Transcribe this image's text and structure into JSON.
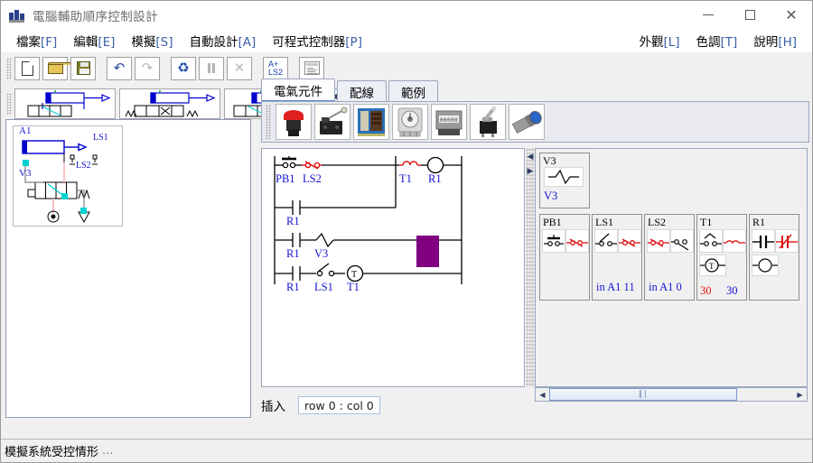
{
  "window": {
    "title": "電腦輔助順序控制設計",
    "icon": "app-icon",
    "controls": {
      "minimize": "—",
      "maximize": "□",
      "close": "✕"
    }
  },
  "menu": {
    "left": [
      {
        "label": "檔案",
        "accel": "[F]"
      },
      {
        "label": "編輯",
        "accel": "[E]"
      },
      {
        "label": "模擬",
        "accel": "[S]"
      },
      {
        "label": "自動設計",
        "accel": "[A]"
      },
      {
        "label": "可程式控制器",
        "accel": "[P]"
      }
    ],
    "right": [
      {
        "label": "外觀",
        "accel": "[L]"
      },
      {
        "label": "色調",
        "accel": "[T]"
      },
      {
        "label": "說明",
        "accel": "[H]"
      }
    ]
  },
  "toolbar": {
    "buttons": [
      {
        "name": "new-file-button",
        "icon": "new-document-icon",
        "enabled": true
      },
      {
        "name": "open-file-button",
        "icon": "open-folder-icon",
        "enabled": true
      },
      {
        "name": "save-file-button",
        "icon": "floppy-save-icon",
        "enabled": true
      },
      {
        "name": "undo-button",
        "icon": "undo-arrow-icon",
        "enabled": true
      },
      {
        "name": "redo-button",
        "icon": "redo-arrow-icon",
        "enabled": false
      },
      {
        "name": "run-simulation-button",
        "icon": "refresh-cycle-icon",
        "enabled": true
      },
      {
        "name": "pause-button",
        "icon": "pause-icon",
        "enabled": false
      },
      {
        "name": "stop-button",
        "icon": "stop-x-icon",
        "enabled": false
      },
      {
        "name": "sequence-button",
        "icon": "a-plus-ls2-icon",
        "label": "A+\nLS2",
        "enabled": true
      },
      {
        "name": "report-button",
        "icon": "document-report-icon",
        "enabled": true
      }
    ],
    "sequence_label_line1": "A+",
    "sequence_label_line2": "LS2"
  },
  "palette": {
    "thumbnails": [
      {
        "name": "circuit-thumb-1",
        "caption": ""
      },
      {
        "name": "circuit-thumb-2",
        "caption": ""
      },
      {
        "name": "circuit-thumb-3",
        "caption": ""
      }
    ],
    "nav_prev": "◀",
    "nav_next": "▶"
  },
  "left_panel": {
    "circuit": {
      "cylinder_label": "A1",
      "valve_label": "V3",
      "switch_labels": [
        "LS1",
        "LS2"
      ]
    }
  },
  "tabs": [
    {
      "label": "電氣元件",
      "name": "tab-electrical-components",
      "active": true
    },
    {
      "label": "配線",
      "name": "tab-wiring",
      "active": false
    },
    {
      "label": "範例",
      "name": "tab-examples",
      "active": false
    }
  ],
  "component_photos": [
    {
      "name": "emergency-stop-button-icon",
      "alt": "emergency stop"
    },
    {
      "name": "limit-switch-icon",
      "alt": "limit switch"
    },
    {
      "name": "relay-module-icon",
      "alt": "relay"
    },
    {
      "name": "timer-icon",
      "alt": "timer"
    },
    {
      "name": "counter-icon",
      "alt": "counter"
    },
    {
      "name": "toggle-switch-icon",
      "alt": "toggle switch"
    },
    {
      "name": "proximity-sensor-icon",
      "alt": "proximity sensor"
    }
  ],
  "ladder": {
    "rungs": [
      {
        "contacts": [
          "PB1",
          "LS2",
          "T1"
        ],
        "coil": "R1"
      },
      {
        "contacts": [
          "R1"
        ],
        "coil": ""
      },
      {
        "contacts": [
          "R1"
        ],
        "coil": "V3"
      },
      {
        "contacts": [
          "R1",
          "LS1"
        ],
        "coil": "T1"
      }
    ],
    "labels_row1": [
      "PB1",
      "LS2",
      "T1",
      "R1"
    ],
    "labels_row2": [
      "R1"
    ],
    "labels_row3": [
      "R1",
      "V3"
    ],
    "labels_row4": [
      "R1",
      "LS1",
      "T1"
    ],
    "selection_color": "#800080"
  },
  "mid_status": {
    "mode": "插入",
    "position": "row 0 : col 0"
  },
  "right_panel": {
    "blocks": [
      {
        "name": "block-v3",
        "title": "V3",
        "sub_label": "V3",
        "values": []
      },
      {
        "name": "block-pb1",
        "title": "PB1",
        "sub_label": "",
        "values": []
      },
      {
        "name": "block-ls1",
        "title": "LS1",
        "sub_label": "in A1 11",
        "values": []
      },
      {
        "name": "block-ls2",
        "title": "LS2",
        "sub_label": "in A1 0",
        "values": []
      },
      {
        "name": "block-t1",
        "title": "T1",
        "sub_label": "",
        "values": [
          "30",
          "30"
        ]
      },
      {
        "name": "block-r1",
        "title": "R1",
        "sub_label": "",
        "values": []
      }
    ],
    "value_red": "30",
    "value_blue": "30",
    "scroll_left": "◀",
    "scroll_right": "▶"
  },
  "statusbar": {
    "text": "模擬系統受控情形",
    "dots": "..."
  },
  "colors": {
    "accent_blue": "#1414d2",
    "contact_red": "#e01010",
    "selection_purple": "#800080",
    "menu_accel": "#3b5fa8"
  }
}
